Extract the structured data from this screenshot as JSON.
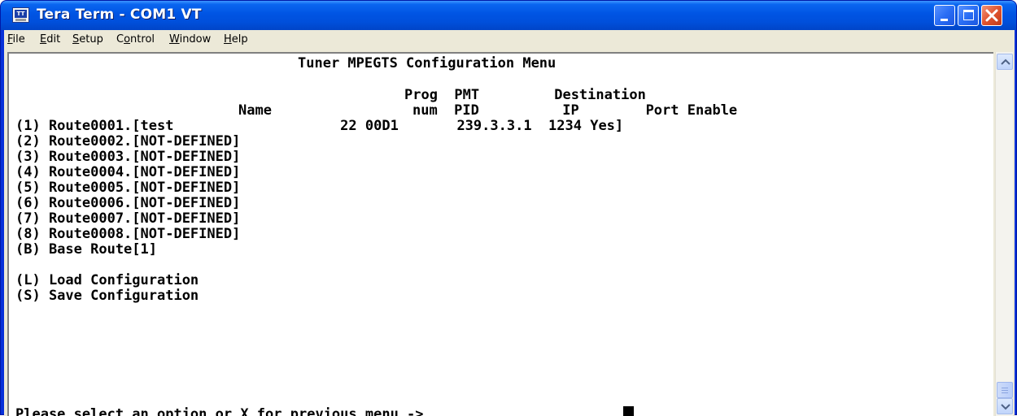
{
  "window": {
    "title": "Tera Term - COM1 VT",
    "icon": "tera-term-icon",
    "icon_label": "TT"
  },
  "menu": [
    {
      "label": "File",
      "access_key": "F"
    },
    {
      "label": "Edit",
      "access_key": "E"
    },
    {
      "label": "Setup",
      "access_key": "S"
    },
    {
      "label": "Control",
      "access_key": "o"
    },
    {
      "label": "Window",
      "access_key": "W"
    },
    {
      "label": "Help",
      "access_key": "H"
    }
  ],
  "terminal": {
    "title": "Tuner MPEGTS Configuration Menu",
    "header_row1": "Prog  PMT         Destination",
    "header_row2_name": "Name",
    "header_row2_rest": "num  PID          IP        Port Enable",
    "routes": [
      "(1) Route0001.[test                    22 00D1       239.3.3.1  1234 Yes]",
      "(2) Route0002.[NOT-DEFINED]",
      "(3) Route0003.[NOT-DEFINED]",
      "(4) Route0004.[NOT-DEFINED]",
      "(5) Route0005.[NOT-DEFINED]",
      "(6) Route0006.[NOT-DEFINED]",
      "(7) Route0007.[NOT-DEFINED]",
      "(8) Route0008.[NOT-DEFINED]",
      "(B) Base Route[1]"
    ],
    "load_option": "(L) Load Configuration",
    "save_option": "(S) Save Configuration",
    "prompt": "Please select an option or X for previous menu ->"
  },
  "colors": {
    "titlebar": "#0054e3",
    "terminal_bg": "#ffffff",
    "terminal_fg": "#000000",
    "close_button": "#e0532f"
  }
}
